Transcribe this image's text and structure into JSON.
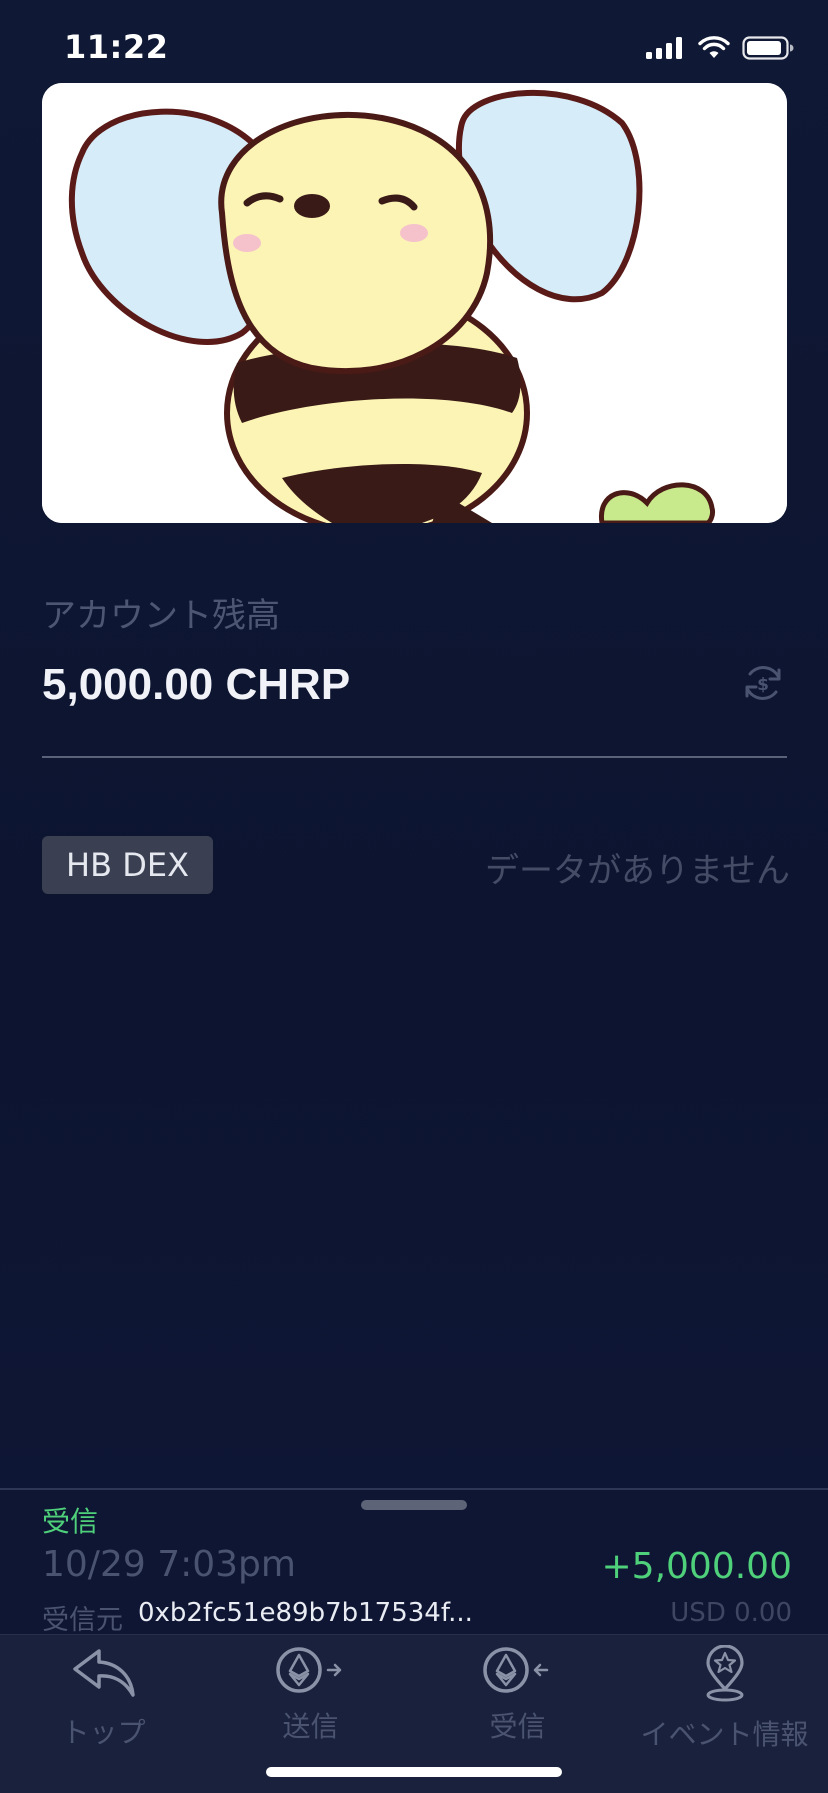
{
  "status_bar": {
    "time": "11:22",
    "icons": [
      "signal-icon",
      "wifi-icon",
      "battery-icon"
    ]
  },
  "banner": {
    "image": "bee-illustration"
  },
  "balance": {
    "label": "アカウント残高",
    "value": "5,000.00 CHRP",
    "refresh_icon": "refresh-dollar-icon"
  },
  "dex": {
    "tag_label": "HB DEX",
    "empty_text": "データがありません"
  },
  "transaction": {
    "type_label": "受信",
    "date": "10/29 7:03pm",
    "amount": "+5,000.00",
    "from_label": "受信元",
    "from_address": "0xb2fc51e89b7b17534f...",
    "usd_value": "USD 0.00"
  },
  "nav": {
    "items": [
      {
        "label": "トップ",
        "icon": "reply-arrow-icon"
      },
      {
        "label": "送信",
        "icon": "eth-send-icon"
      },
      {
        "label": "受信",
        "icon": "eth-receive-icon"
      },
      {
        "label": "イベント情報",
        "icon": "map-pin-star-icon"
      }
    ]
  },
  "colors": {
    "background": "#0f1834",
    "accent_green": "#4fd07a",
    "muted_text": "#4a5370",
    "nav_background": "#19213c"
  }
}
